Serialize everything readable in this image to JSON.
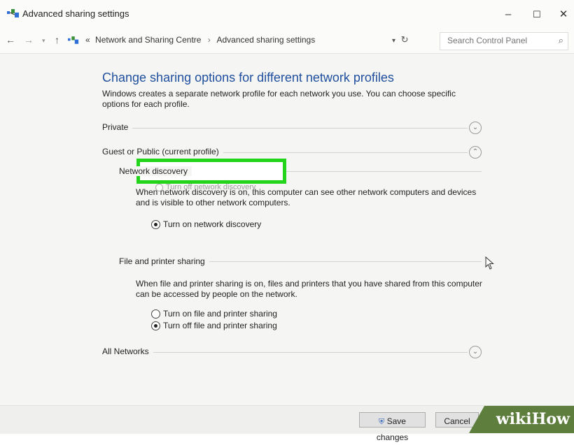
{
  "window": {
    "title": "Advanced sharing settings",
    "controls": {
      "minimize": "–",
      "maximize": "☐",
      "close": "✕"
    }
  },
  "address_bar": {
    "overflow": "«",
    "breadcrumbs": [
      "Network and Sharing Centre",
      "Advanced sharing settings"
    ],
    "search_placeholder": "Search Control Panel"
  },
  "main": {
    "heading": "Change sharing options for different network profiles",
    "description": "Windows creates a separate network profile for each network you use. You can choose specific options for each profile.",
    "profiles": {
      "private": {
        "label": "Private",
        "expanded": false
      },
      "guest_public": {
        "label": "Guest or Public (current profile)",
        "expanded": true
      },
      "all_networks": {
        "label": "All Networks",
        "expanded": false
      }
    },
    "network_discovery": {
      "title": "Network discovery",
      "description": "When network discovery is on, this computer can see other network computers and devices and is visible to other network computers.",
      "option_on": "Turn on network discovery",
      "option_off": "Turn off network discovery",
      "selected": "on"
    },
    "file_printer_sharing": {
      "title": "File and printer sharing",
      "description": "When file and printer sharing is on, files and printers that you have shared from this computer can be accessed by people on the network.",
      "option_on": "Turn on file and printer sharing",
      "option_off": "Turn off file and printer sharing",
      "selected": "off"
    }
  },
  "footer": {
    "save_label": "Save changes",
    "cancel_label": "Cancel"
  },
  "watermark": {
    "text": "wikiHow"
  },
  "colors": {
    "heading": "#1f4f9e",
    "highlight": "#22d51a",
    "watermark_bg": "#5e7e3e"
  },
  "icons": [
    "network-icon",
    "back-arrow-icon",
    "forward-arrow-icon",
    "up-arrow-icon",
    "dropdown-icon",
    "refresh-icon",
    "search-icon",
    "chevron-down-icon",
    "chevron-up-icon",
    "shield-icon",
    "mouse-cursor-icon"
  ]
}
